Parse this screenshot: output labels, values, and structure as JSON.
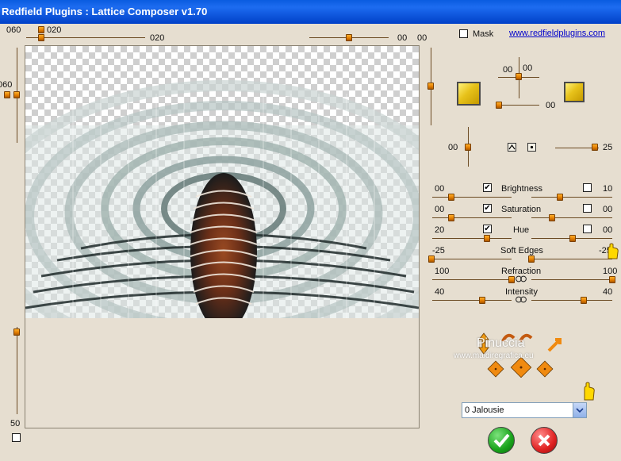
{
  "window": {
    "title": "Redfield Plugins : Lattice Composer v1.70"
  },
  "top": {
    "left_slider_value": "020",
    "left_slider_value2": "020",
    "right_value_a": "00",
    "right_value_b": "00",
    "left_vertical_value": "060",
    "bottom_vertical_value": "50"
  },
  "mask": {
    "label": "Mask",
    "checked": false
  },
  "link": "www.redfieldplugins.com",
  "light": {
    "value_top": "00",
    "value_bottom": "00",
    "swatch_left_color": "#e5bd1c",
    "swatch_right_color": "#e5bd1c"
  },
  "row_mid": {
    "left_value": "00",
    "right_value": "25"
  },
  "adjust": [
    {
      "label": "Brightness",
      "left": "00",
      "right": "10",
      "left_checked": true,
      "right_checked": false
    },
    {
      "label": "Saturation",
      "left": "00",
      "right": "00",
      "left_checked": true,
      "right_checked": false
    },
    {
      "label": "Hue",
      "left": "20",
      "right": "00",
      "left_checked": true,
      "right_checked": false
    }
  ],
  "soft_edges": {
    "label": "Soft Edges",
    "left": "-25",
    "right": "-25"
  },
  "refraction": {
    "label": "Refraction",
    "left": "100",
    "right": "100"
  },
  "intensity": {
    "label": "Intensity",
    "left": "40",
    "right": "40"
  },
  "watermark": {
    "line1": "Pinuccia",
    "line2": "www.maidiregrafica.eu"
  },
  "preset": {
    "selected": "0 Jalousie"
  },
  "buttons": {
    "ok_icon": "check-icon",
    "cancel_icon": "x-icon"
  }
}
